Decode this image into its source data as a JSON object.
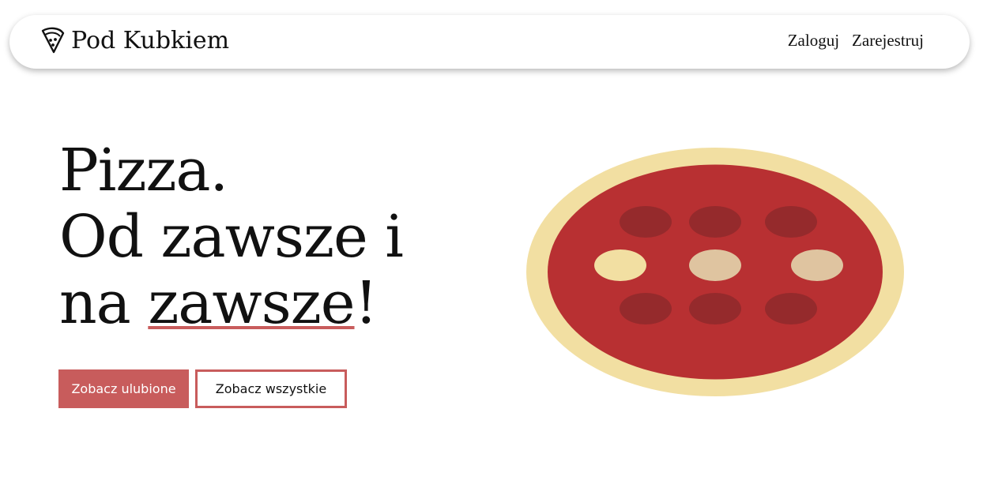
{
  "brand": {
    "name": "Pod Kubkiem",
    "icon": "pizza-slice-icon"
  },
  "nav": {
    "login": "Zaloguj",
    "register": "Zarejestruj"
  },
  "hero": {
    "line1": "Pizza.",
    "line2": "Od zawsze i",
    "line3_prefix": "na ",
    "line3_underlined": "zawsze",
    "line3_suffix": "!"
  },
  "buttons": {
    "favorites": "Zobacz ulubione",
    "all": "Zobacz wszystkie"
  },
  "colors": {
    "accent": "#c85c5c",
    "crust": "#f2dfa2",
    "sauce": "#b83032",
    "pepperoni": "#952a2c",
    "cheese": "#dfc4a0",
    "text": "#111111"
  }
}
